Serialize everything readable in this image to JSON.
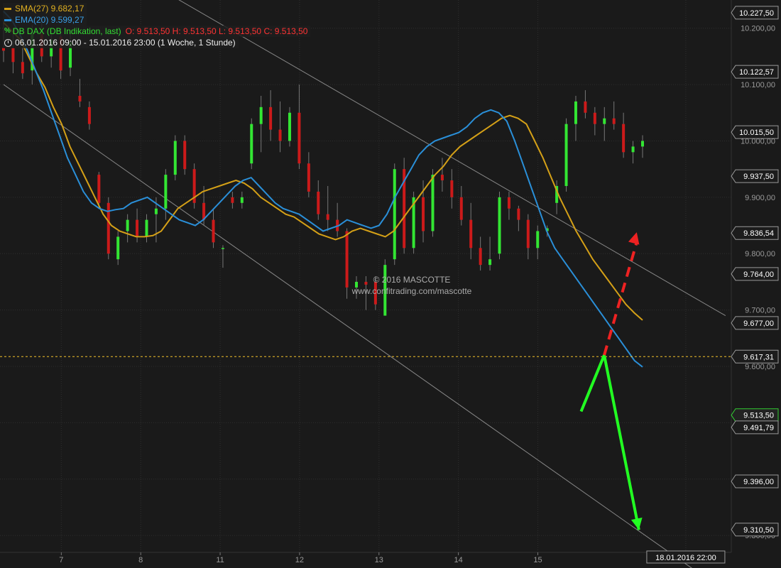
{
  "legend": {
    "sma_label": "SMA(27)  9.682,17",
    "ema_label": "EMA(20)  9.599,27",
    "dax_name": "DB DAX (DB Indikation, last)",
    "dax_ohlc": "O: 9.513,50  H: 9.513,50  L: 9.513,50  C: 9.513,50",
    "period": "06.01.2016 09:00 - 15.01.2016 23:00 (1 Woche, 1 Stunde)",
    "icons": {
      "dax": "candlestick-signal-icon",
      "period": "clock-icon"
    }
  },
  "watermark": {
    "line1": "© 2016 MASCOTTE",
    "line2": "www.confitrading.com/mascotte"
  },
  "colors": {
    "background": "#1a1a1a",
    "bull": "#33e633",
    "bear": "#cc1a1a",
    "sma": "#d4a017",
    "ema": "#2a8fd8",
    "channel": "#888888",
    "arrow_solid": "#22ff22",
    "arrow_dashed": "#ee2222",
    "hline": "#f2c02a"
  },
  "chart_data": {
    "type": "candlestick",
    "title": "DB DAX (DB Indikation, last)",
    "timeframe": "1 Stunde",
    "y_axis": {
      "range": [
        9270,
        10250
      ],
      "ticks": [
        "10.200,00",
        "10.100,00",
        "10.000,00",
        "9.900,00",
        "9.800,00",
        "9.700,00",
        "9.600,00",
        "9.500,00",
        "9.400,00",
        "9.300,00"
      ],
      "tick_values": [
        10200,
        10100,
        10000,
        9900,
        9800,
        9700,
        9600,
        9500,
        9400,
        9300
      ],
      "price_labels": [
        {
          "text": "10.227,50",
          "value": 10227.5
        },
        {
          "text": "10.122,57",
          "value": 10122.57
        },
        {
          "text": "10.015,50",
          "value": 10015.5
        },
        {
          "text": "9.937,50",
          "value": 9937.5
        },
        {
          "text": "9.836,54",
          "value": 9836.54
        },
        {
          "text": "9.764,00",
          "value": 9764
        },
        {
          "text": "9.677,00",
          "value": 9677
        },
        {
          "text": "9.617,31",
          "value": 9617.31
        },
        {
          "text": "9.513,50",
          "value": 9513.5,
          "highlight": true
        },
        {
          "text": "9.491,79",
          "value": 9491.79
        },
        {
          "text": "9.396,00",
          "value": 9396
        },
        {
          "text": "9.310,50",
          "value": 9310.5
        }
      ]
    },
    "x_axis": {
      "range": [
        0,
        89
      ],
      "days": [
        {
          "label": "7",
          "bar": 8
        },
        {
          "label": "8",
          "bar": 19
        },
        {
          "label": "11",
          "bar": 30
        },
        {
          "label": "12",
          "bar": 41
        },
        {
          "label": "13",
          "bar": 52
        },
        {
          "label": "14",
          "bar": 63
        },
        {
          "label": "15",
          "bar": 74
        }
      ],
      "future_label": "18.01.2016 22:00",
      "future_bar": 94.5
    },
    "candles": [
      {
        "o": 10165,
        "h": 10215,
        "l": 10140,
        "c": 10160
      },
      {
        "o": 10165,
        "h": 10200,
        "l": 10120,
        "c": 10140
      },
      {
        "o": 10140,
        "h": 10180,
        "l": 10110,
        "c": 10120
      },
      {
        "o": 10125,
        "h": 10205,
        "l": 10100,
        "c": 10190
      },
      {
        "o": 10190,
        "h": 10220,
        "l": 10140,
        "c": 10150
      },
      {
        "o": 10150,
        "h": 10195,
        "l": 10130,
        "c": 10180
      },
      {
        "o": 10185,
        "h": 10200,
        "l": 10110,
        "c": 10125
      },
      {
        "o": 10130,
        "h": 10195,
        "l": 10115,
        "c": 10175
      },
      {
        "o": 10080,
        "h": 10110,
        "l": 10060,
        "c": 10070
      },
      {
        "o": 10060,
        "h": 10070,
        "l": 10020,
        "c": 10030
      },
      {
        "o": 9940,
        "h": 9945,
        "l": 9880,
        "c": 9890
      },
      {
        "o": 9890,
        "h": 9900,
        "l": 9790,
        "c": 9800
      },
      {
        "o": 9790,
        "h": 9840,
        "l": 9780,
        "c": 9830
      },
      {
        "o": 9840,
        "h": 9870,
        "l": 9820,
        "c": 9860
      },
      {
        "o": 9860,
        "h": 9880,
        "l": 9820,
        "c": 9830
      },
      {
        "o": 9830,
        "h": 9870,
        "l": 9820,
        "c": 9860
      },
      {
        "o": 9870,
        "h": 9900,
        "l": 9820,
        "c": 9880
      },
      {
        "o": 9880,
        "h": 9950,
        "l": 9860,
        "c": 9940
      },
      {
        "o": 9940,
        "h": 10010,
        "l": 9930,
        "c": 10000
      },
      {
        "o": 10000,
        "h": 10010,
        "l": 9940,
        "c": 9950
      },
      {
        "o": 9950,
        "h": 9960,
        "l": 9880,
        "c": 9890
      },
      {
        "o": 9890,
        "h": 9920,
        "l": 9850,
        "c": 9860
      },
      {
        "o": 9860,
        "h": 9880,
        "l": 9810,
        "c": 9820
      },
      {
        "o": 9810,
        "h": 9815,
        "l": 9775,
        "c": 9810
      },
      {
        "o": 9900,
        "h": 9910,
        "l": 9880,
        "c": 9890
      },
      {
        "o": 9890,
        "h": 9910,
        "l": 9880,
        "c": 9900
      },
      {
        "o": 9960,
        "h": 10040,
        "l": 9950,
        "c": 10030
      },
      {
        "o": 10030,
        "h": 10080,
        "l": 9980,
        "c": 10060
      },
      {
        "o": 10060,
        "h": 10090,
        "l": 10000,
        "c": 10020
      },
      {
        "o": 10020,
        "h": 10070,
        "l": 9980,
        "c": 10000
      },
      {
        "o": 10000,
        "h": 10060,
        "l": 9990,
        "c": 10050
      },
      {
        "o": 10050,
        "h": 10100,
        "l": 9950,
        "c": 9960
      },
      {
        "o": 9960,
        "h": 9980,
        "l": 9900,
        "c": 9910
      },
      {
        "o": 9910,
        "h": 9930,
        "l": 9860,
        "c": 9870
      },
      {
        "o": 9870,
        "h": 9920,
        "l": 9840,
        "c": 9860
      },
      {
        "o": 9860,
        "h": 9890,
        "l": 9830,
        "c": 9840
      },
      {
        "o": 9840,
        "h": 9845,
        "l": 9720,
        "c": 9740
      },
      {
        "o": 9740,
        "h": 9760,
        "l": 9720,
        "c": 9750
      },
      {
        "o": 9750,
        "h": 9760,
        "l": 9700,
        "c": 9745
      },
      {
        "o": 9750,
        "h": 9760,
        "l": 9700,
        "c": 9710
      },
      {
        "o": 9690,
        "h": 9790,
        "l": 9690,
        "c": 9780
      },
      {
        "o": 9790,
        "h": 9960,
        "l": 9780,
        "c": 9950
      },
      {
        "o": 9950,
        "h": 9970,
        "l": 9800,
        "c": 9810
      },
      {
        "o": 9810,
        "h": 9910,
        "l": 9800,
        "c": 9900
      },
      {
        "o": 9900,
        "h": 9930,
        "l": 9820,
        "c": 9840
      },
      {
        "o": 9840,
        "h": 9950,
        "l": 9830,
        "c": 9940
      },
      {
        "o": 9940,
        "h": 9970,
        "l": 9910,
        "c": 9930
      },
      {
        "o": 9930,
        "h": 9950,
        "l": 9880,
        "c": 9900
      },
      {
        "o": 9900,
        "h": 9920,
        "l": 9850,
        "c": 9860
      },
      {
        "o": 9860,
        "h": 9890,
        "l": 9790,
        "c": 9810
      },
      {
        "o": 9810,
        "h": 9830,
        "l": 9770,
        "c": 9780
      },
      {
        "o": 9780,
        "h": 9830,
        "l": 9770,
        "c": 9790
      },
      {
        "o": 9800,
        "h": 9910,
        "l": 9790,
        "c": 9900
      },
      {
        "o": 9900,
        "h": 9910,
        "l": 9860,
        "c": 9880
      },
      {
        "o": 9880,
        "h": 9885,
        "l": 9840,
        "c": 9860
      },
      {
        "o": 9860,
        "h": 9870,
        "l": 9790,
        "c": 9810
      },
      {
        "o": 9810,
        "h": 9850,
        "l": 9790,
        "c": 9840
      },
      {
        "o": 9840,
        "h": 9850,
        "l": 9830,
        "c": 9845
      },
      {
        "o": 9890,
        "h": 9930,
        "l": 9870,
        "c": 9920
      },
      {
        "o": 9920,
        "h": 10040,
        "l": 9910,
        "c": 10030
      },
      {
        "o": 10030,
        "h": 10080,
        "l": 10000,
        "c": 10070
      },
      {
        "o": 10070,
        "h": 10090,
        "l": 10040,
        "c": 10050
      },
      {
        "o": 10050,
        "h": 10060,
        "l": 10010,
        "c": 10030
      },
      {
        "o": 10030,
        "h": 10060,
        "l": 10000,
        "c": 10040
      },
      {
        "o": 10040,
        "h": 10070,
        "l": 10020,
        "c": 10030
      },
      {
        "o": 10030,
        "h": 10050,
        "l": 9970,
        "c": 9980
      },
      {
        "o": 9980,
        "h": 10000,
        "l": 9960,
        "c": 9990
      },
      {
        "o": 9990,
        "h": 10010,
        "l": 9970,
        "c": 10000
      }
    ],
    "sma": {
      "name": "SMA(27)",
      "values": [
        10210,
        10195,
        10180,
        10150,
        10120,
        10095,
        10060,
        10030,
        9990,
        9960,
        9930,
        9900,
        9870,
        9850,
        9840,
        9835,
        9830,
        9830,
        9832,
        9840,
        9860,
        9880,
        9890,
        9900,
        9910,
        9915,
        9920,
        9925,
        9930,
        9925,
        9915,
        9900,
        9890,
        9880,
        9870,
        9865,
        9855,
        9845,
        9835,
        9830,
        9825,
        9830,
        9840,
        9845,
        9840,
        9835,
        9830,
        9840,
        9860,
        9880,
        9900,
        9920,
        9940,
        9955,
        9975,
        9990,
        10000,
        10010,
        10020,
        10030,
        10040,
        10045,
        10040,
        10030,
        10000,
        9970,
        9935,
        9900,
        9870,
        9840,
        9815,
        9790,
        9770,
        9750,
        9730,
        9710,
        9695,
        9682
      ]
    },
    "ema": {
      "name": "EMA(20)",
      "values": [
        10230,
        10215,
        10190,
        10160,
        10125,
        10090,
        10050,
        10010,
        9970,
        9940,
        9910,
        9890,
        9880,
        9875,
        9878,
        9880,
        9890,
        9895,
        9900,
        9890,
        9880,
        9870,
        9860,
        9855,
        9850,
        9860,
        9875,
        9890,
        9905,
        9920,
        9930,
        9935,
        9920,
        9905,
        9890,
        9880,
        9875,
        9870,
        9860,
        9850,
        9840,
        9845,
        9850,
        9860,
        9855,
        9850,
        9845,
        9850,
        9870,
        9900,
        9925,
        9950,
        9975,
        9990,
        10000,
        10005,
        10010,
        10015,
        10025,
        10040,
        10050,
        10055,
        10050,
        10035,
        10000,
        9960,
        9920,
        9880,
        9840,
        9810,
        9790,
        9770,
        9750,
        9730,
        9710,
        9690,
        9670,
        9650,
        9630,
        9610,
        9599
      ]
    },
    "channel": {
      "upper": [
        {
          "bar": 0,
          "value": 10430
        },
        {
          "bar": 100,
          "value": 9690
        }
      ],
      "lower": [
        {
          "bar": 0,
          "value": 10100
        },
        {
          "bar": 100,
          "value": 9200
        }
      ]
    },
    "horizontal_line": 9617.31,
    "projection": {
      "solid_path": [
        {
          "bar": 80,
          "value": 9520
        },
        {
          "bar": 83.2,
          "value": 9620
        },
        {
          "bar": 88,
          "value": 9310
        }
      ],
      "dashed_path": [
        {
          "bar": 83.2,
          "value": 9620
        },
        {
          "bar": 87.7,
          "value": 9838
        }
      ]
    }
  }
}
